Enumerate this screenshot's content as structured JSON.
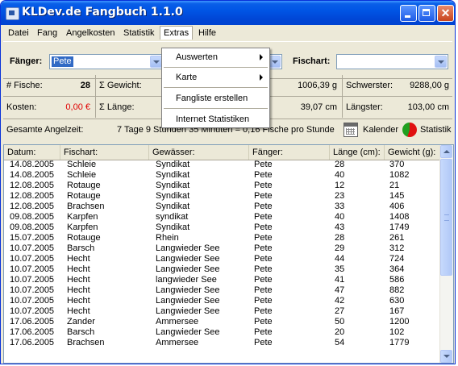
{
  "window": {
    "title": "KLDev.de Fangbuch 1.1.0"
  },
  "menubar": [
    "Datei",
    "Fang",
    "Angelkosten",
    "Statistik",
    "Extras",
    "Hilfe"
  ],
  "extras_menu": {
    "items": [
      {
        "label": "Auswerten",
        "submenu": true
      },
      {
        "label": "Karte",
        "submenu": true
      },
      {
        "label": "Fangliste erstellen",
        "submenu": false
      },
      {
        "label": "Internet Statistiken",
        "submenu": false
      }
    ]
  },
  "filters": {
    "faenger_label": "Fänger:",
    "faenger_value": "Pete",
    "fischart_label": "Fischart:",
    "fischart_value": ""
  },
  "stats": {
    "fische_label": "# Fische:",
    "fische_value": "28",
    "gewicht_label": "Σ Gewicht:",
    "avg_gewicht_value": "1006,39 g",
    "schwerster_label": "Schwerster:",
    "schwerster_value": "9288,00 g",
    "kosten_label": "Kosten:",
    "kosten_value": "0,00 €",
    "laenge_label": "Σ Länge:",
    "avg_laenge_value": "39,07 cm",
    "laengster_label": "Längster:",
    "laengster_value": "103,00 cm",
    "angelzeit_label": "Gesamte Angelzeit:",
    "angelzeit_value": "7 Tage 9 Stunden 35 Minuten = 0,16 Fische pro Stunde",
    "kalender_label": "Kalender",
    "statistik_label": "Statistik"
  },
  "colors": {
    "kosten_value": "#e00000",
    "selection": "#316ac5",
    "titlebar": "#0055e5"
  },
  "table": {
    "columns": [
      "Datum:",
      "Fischart:",
      "Gewässer:",
      "Fänger:",
      "Länge (cm):",
      "Gewicht (g):"
    ],
    "rows": [
      [
        "14.08.2005",
        "Schleie",
        "Syndikat",
        "Pete",
        "28",
        "370"
      ],
      [
        "14.08.2005",
        "Schleie",
        "Syndikat",
        "Pete",
        "40",
        "1082"
      ],
      [
        "12.08.2005",
        "Rotauge",
        "Syndikat",
        "Pete",
        "12",
        "21"
      ],
      [
        "12.08.2005",
        "Rotauge",
        "Syndikat",
        "Pete",
        "23",
        "145"
      ],
      [
        "12.08.2005",
        "Brachsen",
        "Syndikat",
        "Pete",
        "33",
        "406"
      ],
      [
        "09.08.2005",
        "Karpfen",
        "syndikat",
        "Pete",
        "40",
        "1408"
      ],
      [
        "09.08.2005",
        "Karpfen",
        "Syndikat",
        "Pete",
        "43",
        "1749"
      ],
      [
        "15.07.2005",
        "Rotauge",
        "Rhein",
        "Pete",
        "28",
        "261"
      ],
      [
        "10.07.2005",
        "Barsch",
        "Langwieder See",
        "Pete",
        "29",
        "312"
      ],
      [
        "10.07.2005",
        "Hecht",
        "Langwieder See",
        "Pete",
        "44",
        "724"
      ],
      [
        "10.07.2005",
        "Hecht",
        "Langwieder See",
        "Pete",
        "35",
        "364"
      ],
      [
        "10.07.2005",
        "Hecht",
        "langwieder See",
        "Pete",
        "41",
        "586"
      ],
      [
        "10.07.2005",
        "Hecht",
        "Langwieder See",
        "Pete",
        "47",
        "882"
      ],
      [
        "10.07.2005",
        "Hecht",
        "Langwieder See",
        "Pete",
        "42",
        "630"
      ],
      [
        "10.07.2005",
        "Hecht",
        "Langwieder See",
        "Pete",
        "27",
        "167"
      ],
      [
        "17.06.2005",
        "Zander",
        "Ammersee",
        "Pete",
        "50",
        "1200"
      ],
      [
        "17.06.2005",
        "Barsch",
        "Langwieder See",
        "Pete",
        "20",
        "102"
      ],
      [
        "17.06.2005",
        "Brachsen",
        "Ammersee",
        "Pete",
        "54",
        "1779"
      ]
    ]
  }
}
